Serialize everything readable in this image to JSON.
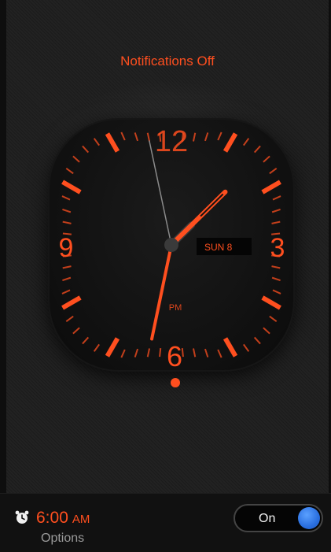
{
  "status": {
    "notifications": "Notifications Off"
  },
  "clock": {
    "numerals": {
      "n12": "12",
      "n3": "3",
      "n6": "6",
      "n9": "9"
    },
    "date": "SUN 8",
    "period": "PM",
    "accent": "#ff4f1f",
    "time": {
      "hour": 1,
      "minute": 31,
      "second": 58
    }
  },
  "pager": {
    "pages": 1,
    "current": 1
  },
  "alarm": {
    "icon": "alarm-clock-icon",
    "time": "6:00",
    "ampm": "AM",
    "options_label": "Options",
    "toggle_label": "On",
    "toggle_on": true,
    "toggle_color": "#2a6fe0"
  }
}
